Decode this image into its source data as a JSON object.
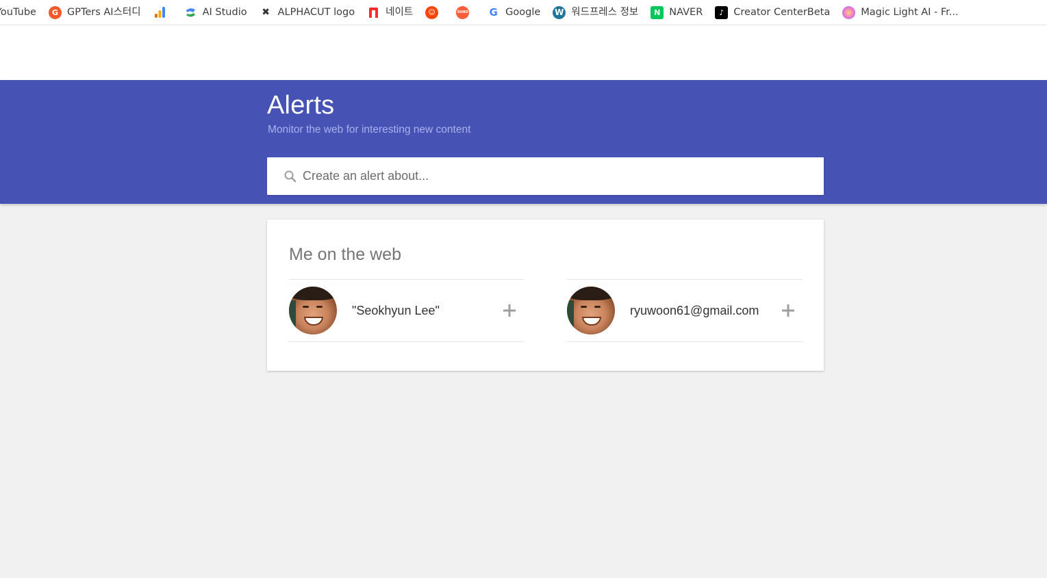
{
  "bookmarks": [
    {
      "label": "YouTube",
      "icon": "youtube-icon",
      "color": "#ff0000"
    },
    {
      "label": "GPTers AI스터디",
      "icon": "gpters-icon",
      "color": "#f05a28"
    },
    {
      "label": "",
      "icon": "analytics-icon",
      "color": "#f9ab00"
    },
    {
      "label": "AI Studio",
      "icon": "ai-studio-icon",
      "color": "#4285f4"
    },
    {
      "label": "ALPHACUT logo",
      "icon": "alphacut-icon",
      "color": "#333333"
    },
    {
      "label": "네이트",
      "icon": "nate-icon",
      "color": "#ff3a3a"
    },
    {
      "label": "",
      "icon": "reddit-icon",
      "color": "#ff4500"
    },
    {
      "label": "",
      "icon": "suno-icon",
      "color": "#ff5c3a"
    },
    {
      "label": "Google",
      "icon": "google-icon",
      "color": "#4285f4"
    },
    {
      "label": "워드프레스 정보",
      "icon": "wordpress-icon",
      "color": "#21759b"
    },
    {
      "label": "NAVER",
      "icon": "naver-icon",
      "color": "#03c75a"
    },
    {
      "label": "Creator CenterBeta",
      "icon": "tiktok-icon",
      "color": "#000000"
    },
    {
      "label": "Magic Light AI - Fr...",
      "icon": "magic-light-icon",
      "color": "#b36cf0"
    }
  ],
  "header": {
    "title": "Alerts",
    "subtitle": "Monitor the web for interesting new content",
    "background": "#4752b5"
  },
  "search": {
    "placeholder": "Create an alert about...",
    "value": ""
  },
  "me_on_web": {
    "title": "Me on the web",
    "suggestions": [
      {
        "label": "\"Seokhyun Lee\""
      },
      {
        "label": "ryuwoon61@gmail.com"
      }
    ]
  }
}
